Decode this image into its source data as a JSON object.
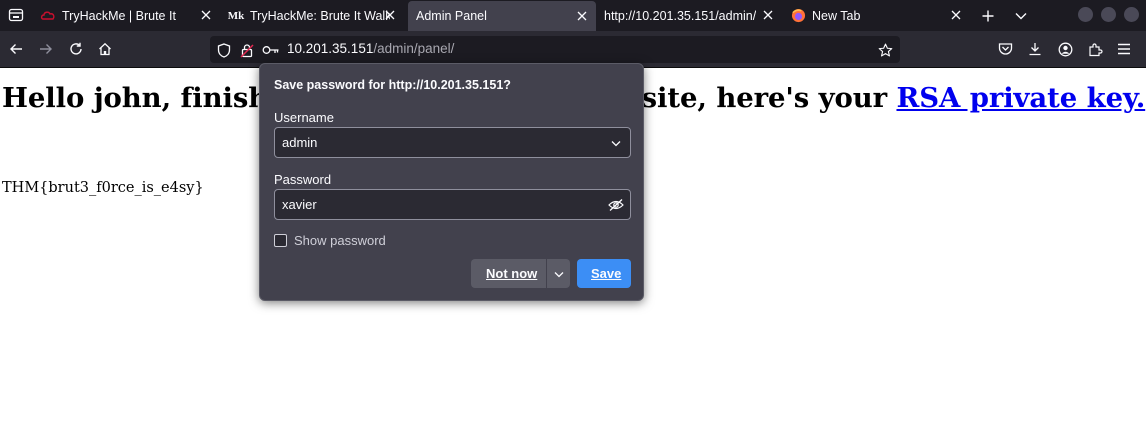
{
  "tabs": [
    {
      "title": "TryHackMe | Brute It",
      "favicon": "tryhackme-icon"
    },
    {
      "title": "TryHackMe: Brute It Walk",
      "favicon": "medium-icon"
    },
    {
      "title": "Admin Panel",
      "favicon": ""
    },
    {
      "title": "http://10.201.35.151/admin/",
      "favicon": ""
    },
    {
      "title": "New Tab",
      "favicon": "firefox-icon"
    }
  ],
  "address_bar": {
    "host": "10.201.35.151",
    "path": "/admin/panel/"
  },
  "page": {
    "heading_text": "Hello john, finish the development of the site, here's your",
    "heading_link": "RSA private key.",
    "flag": "THM{brut3_f0rce_is_e4sy}"
  },
  "save_password_popup": {
    "title": "Save password for http://10.201.35.151?",
    "username_label": "Username",
    "username_value": "admin",
    "password_label": "Password",
    "password_value": "xavier",
    "show_password_label": "Show password",
    "not_now_label": "Not now",
    "save_label": "Save"
  },
  "colors": {
    "tab_strip": "#1c1b22",
    "toolbar": "#2b2a33",
    "popup_bg": "#42414d",
    "save_button": "#3c8ef5",
    "link": "#0000ee"
  }
}
